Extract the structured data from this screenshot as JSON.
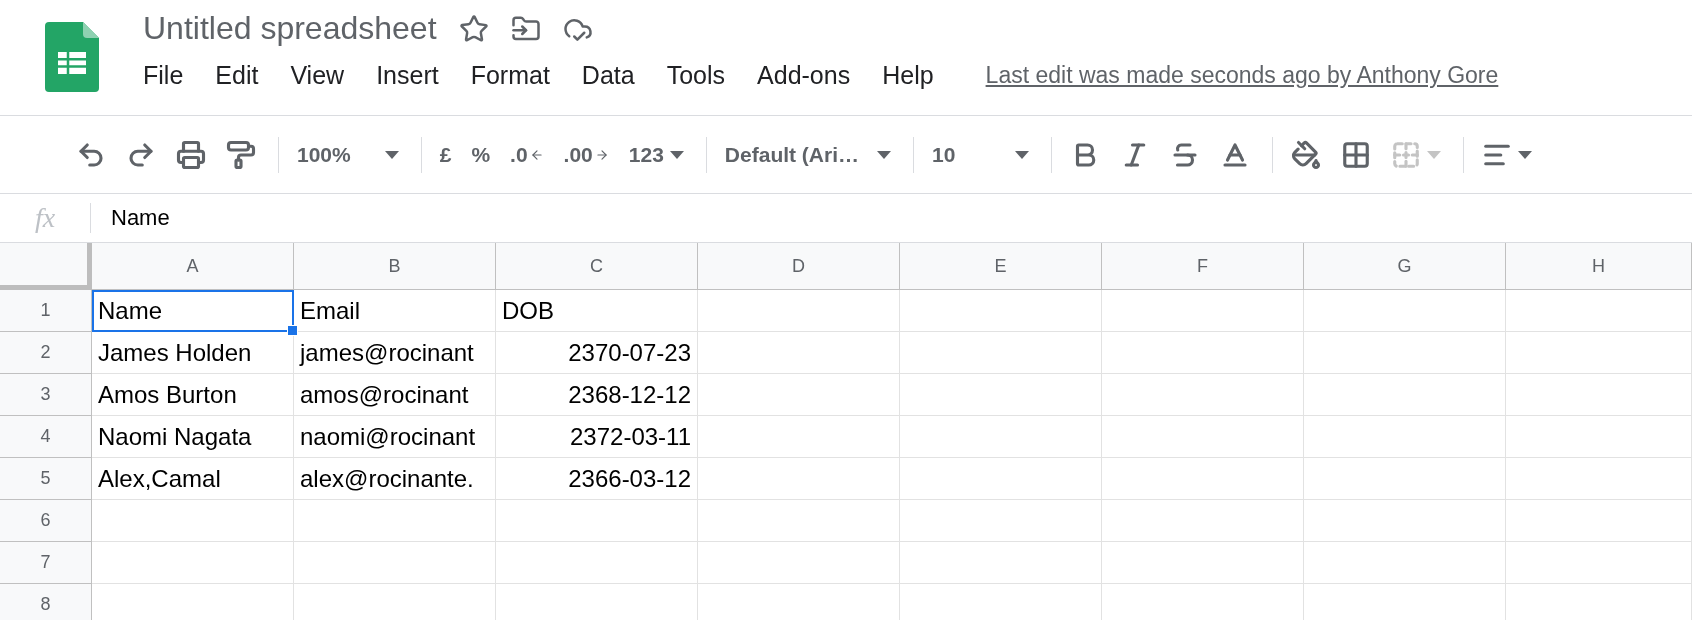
{
  "document": {
    "title": "Untitled spreadsheet",
    "last_edit": "Last edit was made seconds ago by Anthony Gore"
  },
  "menu": [
    "File",
    "Edit",
    "View",
    "Insert",
    "Format",
    "Data",
    "Tools",
    "Add-ons",
    "Help"
  ],
  "toolbar": {
    "zoom": "100%",
    "currency": "£",
    "percent": "%",
    "decrease_decimals": ".0",
    "increase_decimals": ".00",
    "number_format": "123",
    "font": "Default (Ari…",
    "font_size": "10",
    "merge_disabled": true
  },
  "formula_bar": {
    "label": "fx",
    "value": "Name"
  },
  "columns": [
    "A",
    "B",
    "C",
    "D",
    "E",
    "F",
    "G",
    "H"
  ],
  "rows": [
    {
      "header": "1",
      "cells": [
        {
          "kind": "text",
          "text": "Name",
          "selected": true
        },
        {
          "kind": "text",
          "text": "Email",
          "selected": false
        },
        {
          "kind": "text",
          "text": "DOB",
          "selected": false
        }
      ]
    },
    {
      "header": "2",
      "cells": [
        {
          "kind": "text",
          "text": "James Holden",
          "selected": false
        },
        {
          "kind": "text",
          "text": "james@rocinant",
          "selected": false
        },
        {
          "kind": "date",
          "text": "2370-07-23",
          "selected": false
        }
      ]
    },
    {
      "header": "3",
      "cells": [
        {
          "kind": "text",
          "text": "Amos Burton",
          "selected": false
        },
        {
          "kind": "text",
          "text": "amos@rocinant",
          "selected": false
        },
        {
          "kind": "date",
          "text": "2368-12-12",
          "selected": false
        }
      ]
    },
    {
      "header": "4",
      "cells": [
        {
          "kind": "text",
          "text": "Naomi Nagata",
          "selected": false
        },
        {
          "kind": "text",
          "text": "naomi@rocinant",
          "selected": false
        },
        {
          "kind": "date",
          "text": "2372-03-11",
          "selected": false
        }
      ]
    },
    {
      "header": "5",
      "cells": [
        {
          "kind": "text",
          "text": "Alex,Camal",
          "selected": false
        },
        {
          "kind": "text",
          "text": "alex@rocinante.",
          "selected": false
        },
        {
          "kind": "date",
          "text": "2366-03-12",
          "selected": false
        }
      ]
    },
    {
      "header": "6",
      "cells": []
    },
    {
      "header": "7",
      "cells": []
    },
    {
      "header": "8",
      "cells": []
    }
  ]
}
